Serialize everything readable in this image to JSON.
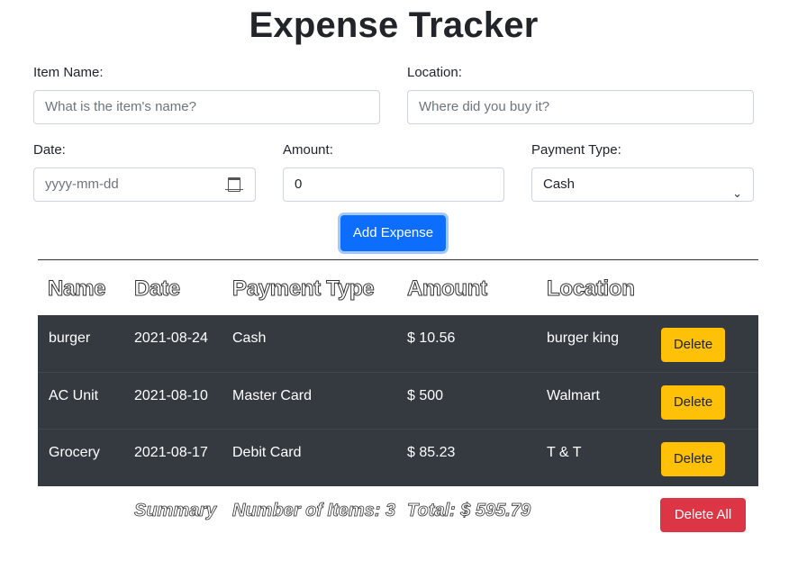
{
  "title": "Expense Tracker",
  "form": {
    "item_name": {
      "label": "Item Name:",
      "placeholder": "What is the item's name?"
    },
    "location": {
      "label": "Location:",
      "placeholder": "Where did you buy it?"
    },
    "date": {
      "label": "Date:",
      "placeholder": "yyyy-mm-dd"
    },
    "amount": {
      "label": "Amount:",
      "value": "0"
    },
    "payment_type": {
      "label": "Payment Type:",
      "selected": "Cash"
    },
    "add_button": "Add Expense"
  },
  "table": {
    "headers": [
      "Name",
      "Date",
      "Payment Type",
      "Amount",
      "Location"
    ],
    "rows": [
      {
        "name": "burger",
        "date": "2021-08-24",
        "payment": "Cash",
        "amount": "$ 10.56",
        "location": "burger king",
        "action": "Delete"
      },
      {
        "name": "AC Unit",
        "date": "2021-08-10",
        "payment": "Master Card",
        "amount": "$ 500",
        "location": "Walmart",
        "action": "Delete"
      },
      {
        "name": "Grocery",
        "date": "2021-08-17",
        "payment": "Debit Card",
        "amount": "$ 85.23",
        "location": "T & T",
        "action": "Delete"
      }
    ]
  },
  "summary": {
    "label": "Summary",
    "count": "Number of Items: 3",
    "total": "Total: $ 595.79",
    "delete_all": "Delete All"
  },
  "colors": {
    "primary": "#0d6efd",
    "warning": "#ffc107",
    "danger": "#dc3545",
    "table_dark": "#343a40"
  }
}
